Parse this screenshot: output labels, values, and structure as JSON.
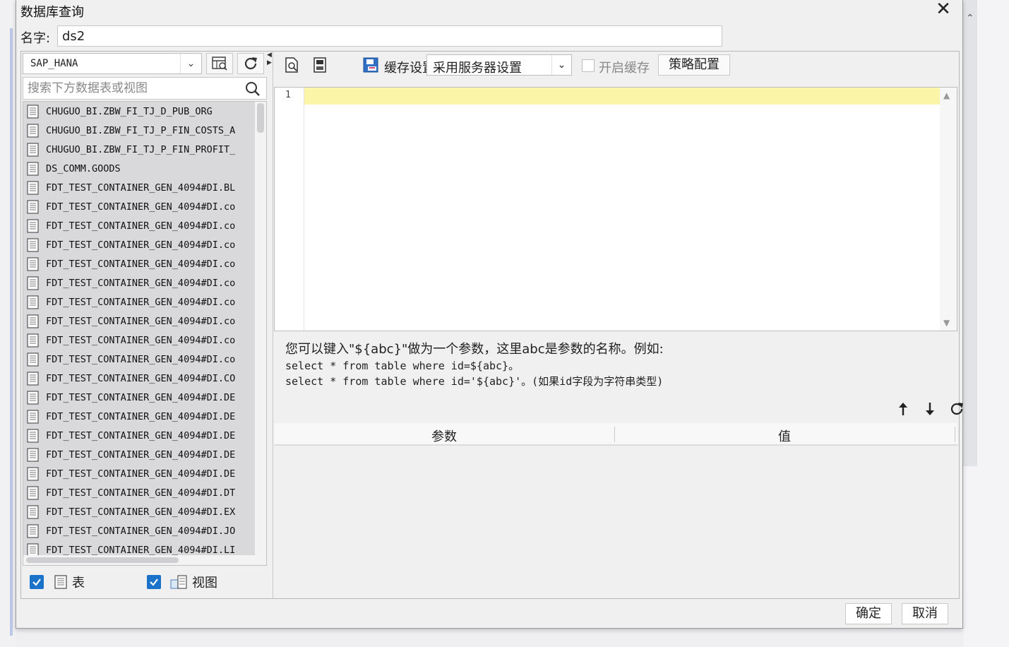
{
  "dialog": {
    "title": "数据库查询",
    "close_icon": "close-icon"
  },
  "name": {
    "label": "名字:",
    "value": "ds2"
  },
  "left": {
    "connection": "SAP_HANA",
    "search_placeholder": "搜索下方数据表或视图",
    "tables": [
      "CHUGUO_BI.ZBW_FI_TJ_D_PUB_ORG",
      "CHUGUO_BI.ZBW_FI_TJ_P_FIN_COSTS_A",
      "CHUGUO_BI.ZBW_FI_TJ_P_FIN_PROFIT_",
      "DS_COMM.GOODS",
      "FDT_TEST_CONTAINER_GEN_4094#DI.BL",
      "FDT_TEST_CONTAINER_GEN_4094#DI.co",
      "FDT_TEST_CONTAINER_GEN_4094#DI.co",
      "FDT_TEST_CONTAINER_GEN_4094#DI.co",
      "FDT_TEST_CONTAINER_GEN_4094#DI.co",
      "FDT_TEST_CONTAINER_GEN_4094#DI.co",
      "FDT_TEST_CONTAINER_GEN_4094#DI.co",
      "FDT_TEST_CONTAINER_GEN_4094#DI.co",
      "FDT_TEST_CONTAINER_GEN_4094#DI.co",
      "FDT_TEST_CONTAINER_GEN_4094#DI.co",
      "FDT_TEST_CONTAINER_GEN_4094#DI.CO",
      "FDT_TEST_CONTAINER_GEN_4094#DI.DE",
      "FDT_TEST_CONTAINER_GEN_4094#DI.DE",
      "FDT_TEST_CONTAINER_GEN_4094#DI.DE",
      "FDT_TEST_CONTAINER_GEN_4094#DI.DE",
      "FDT_TEST_CONTAINER_GEN_4094#DI.DE",
      "FDT_TEST_CONTAINER_GEN_4094#DI.DT",
      "FDT_TEST_CONTAINER_GEN_4094#DI.EX",
      "FDT_TEST_CONTAINER_GEN_4094#DI.JO",
      "FDT_TEST_CONTAINER_GEN_4094#DI.LI"
    ],
    "filter_table_label": "表",
    "filter_view_label": "视图"
  },
  "toolbar": {
    "cache_label": "缓存设置",
    "cache_value": "采用服务器设置",
    "enable_cache_label": "开启缓存",
    "policy_button": "策略配置"
  },
  "editor": {
    "line_number": "1"
  },
  "hint": {
    "line1": "您可以键入\"${abc}\"做为一个参数，这里abc是参数的名称。例如:",
    "line2": "select * from table where id=${abc}。",
    "line3": "select * from table where id='${abc}'。(如果id字段为字符串类型)"
  },
  "params": {
    "col_param": "参数",
    "col_value": "值"
  },
  "footer": {
    "ok": "确定",
    "cancel": "取消"
  },
  "colors": {
    "accent": "#1a73c9",
    "current_line": "#fbf5a8",
    "list_bg": "#d9d9db"
  }
}
